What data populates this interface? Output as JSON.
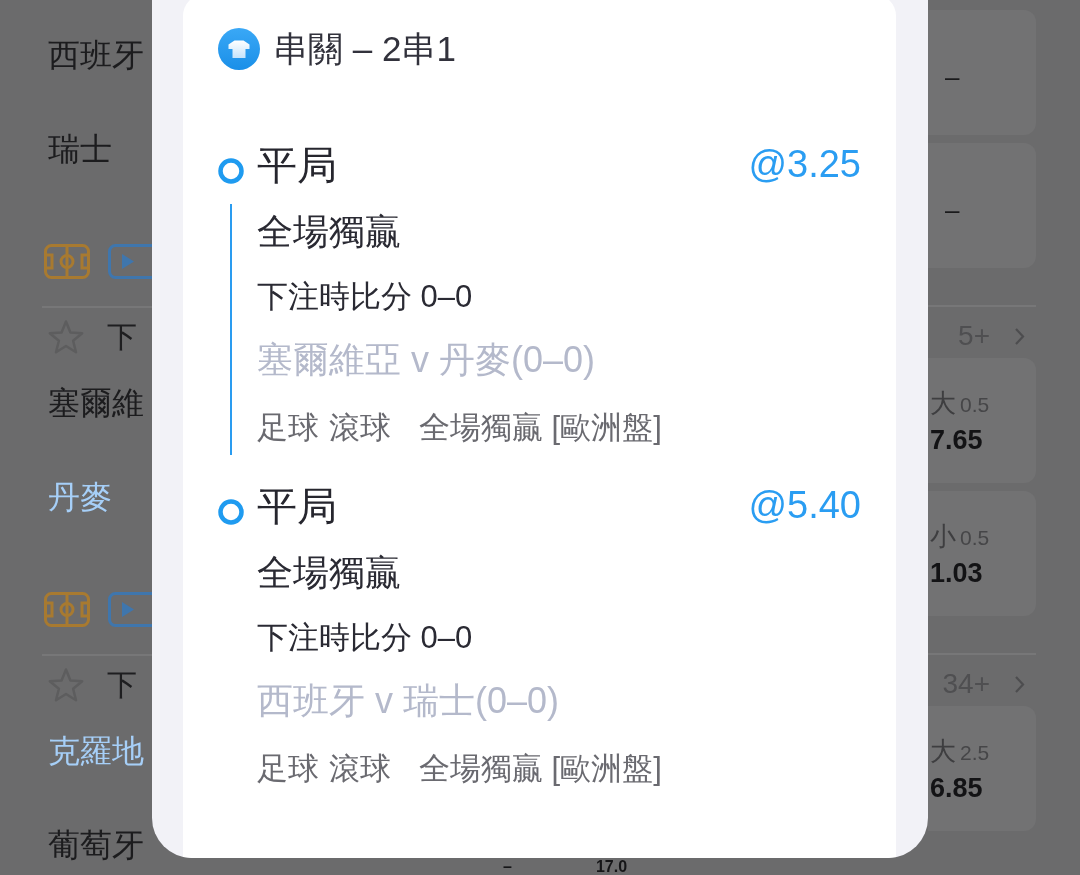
{
  "backdrop": {
    "left_column": [
      {
        "kind": "team",
        "name": "西班牙",
        "highlighted": false
      },
      {
        "kind": "team",
        "name": "瑞士",
        "highlighted": false
      },
      {
        "kind": "icons"
      },
      {
        "kind": "header",
        "label": "下",
        "starred": false
      },
      {
        "kind": "team",
        "name": "塞爾維",
        "highlighted": false
      },
      {
        "kind": "team",
        "name": "丹麥",
        "highlighted": true
      },
      {
        "kind": "icons"
      },
      {
        "kind": "header",
        "label": "下",
        "starred": false
      },
      {
        "kind": "team",
        "name": "克羅地",
        "highlighted": true
      },
      {
        "kind": "team",
        "name": "葡萄牙",
        "highlighted": false
      }
    ],
    "right_column": [
      {
        "kind": "odds",
        "value": "–"
      },
      {
        "kind": "odds",
        "value": "–"
      },
      {
        "kind": "header",
        "count": "5+"
      },
      {
        "kind": "odds",
        "side": "大",
        "line": "0.5",
        "value": "7.65"
      },
      {
        "kind": "odds",
        "side": "小",
        "line": "0.5",
        "value": "1.03"
      },
      {
        "kind": "header",
        "count": "34+"
      },
      {
        "kind": "odds",
        "side": "大",
        "line": "2.5",
        "value": "6.85"
      }
    ],
    "bottom_row": [
      "–",
      "17.0"
    ]
  },
  "bet_slip": {
    "title": "串關 – 2串1",
    "legs": [
      {
        "selection": "平局",
        "odds": "@3.25",
        "market": "全場獨贏",
        "score": "下注時比分 0–0",
        "match": "塞爾維亞 v 丹麥(0–0)",
        "sport": "足球",
        "mode": "滾球",
        "market_type": "全場獨贏 [歐洲盤]"
      },
      {
        "selection": "平局",
        "odds": "@5.40",
        "market": "全場獨贏",
        "score": "下注時比分 0–0",
        "match": "西班牙 v 瑞士(0–0)",
        "sport": "足球",
        "mode": "滾球",
        "market_type": "全場獨贏 [歐洲盤]"
      }
    ]
  }
}
